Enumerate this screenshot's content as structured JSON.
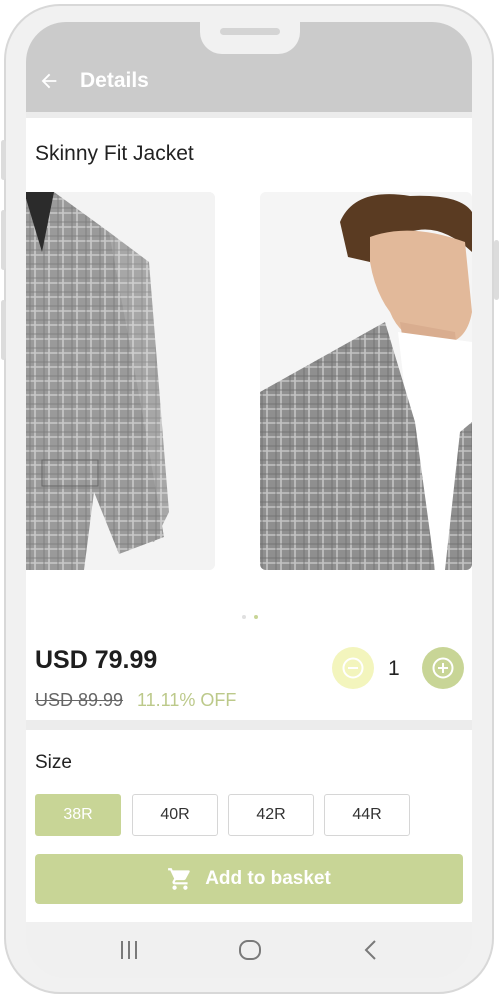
{
  "appbar": {
    "title": "Details",
    "back_icon": "arrow-left-icon"
  },
  "product": {
    "title": "Skinny Fit Jacket",
    "image_count": 2,
    "active_image_index": 1,
    "price": "USD 79.99",
    "original_price": "USD 89.99",
    "discount": "11.11% OFF",
    "quantity": "1"
  },
  "size_section": {
    "label": "Size",
    "options": [
      "38R",
      "40R",
      "42R",
      "44R"
    ],
    "selected": "38R"
  },
  "add_button": {
    "label": "Add to basket",
    "icon": "cart-icon"
  },
  "navbar": {
    "icons": [
      "recent-apps-icon",
      "home-icon",
      "back-icon"
    ]
  },
  "colors": {
    "accent": "#c8d596",
    "accent_light": "#f3f5bd",
    "discount_text": "#bcc98a",
    "appbar": "#cbcbcb"
  }
}
